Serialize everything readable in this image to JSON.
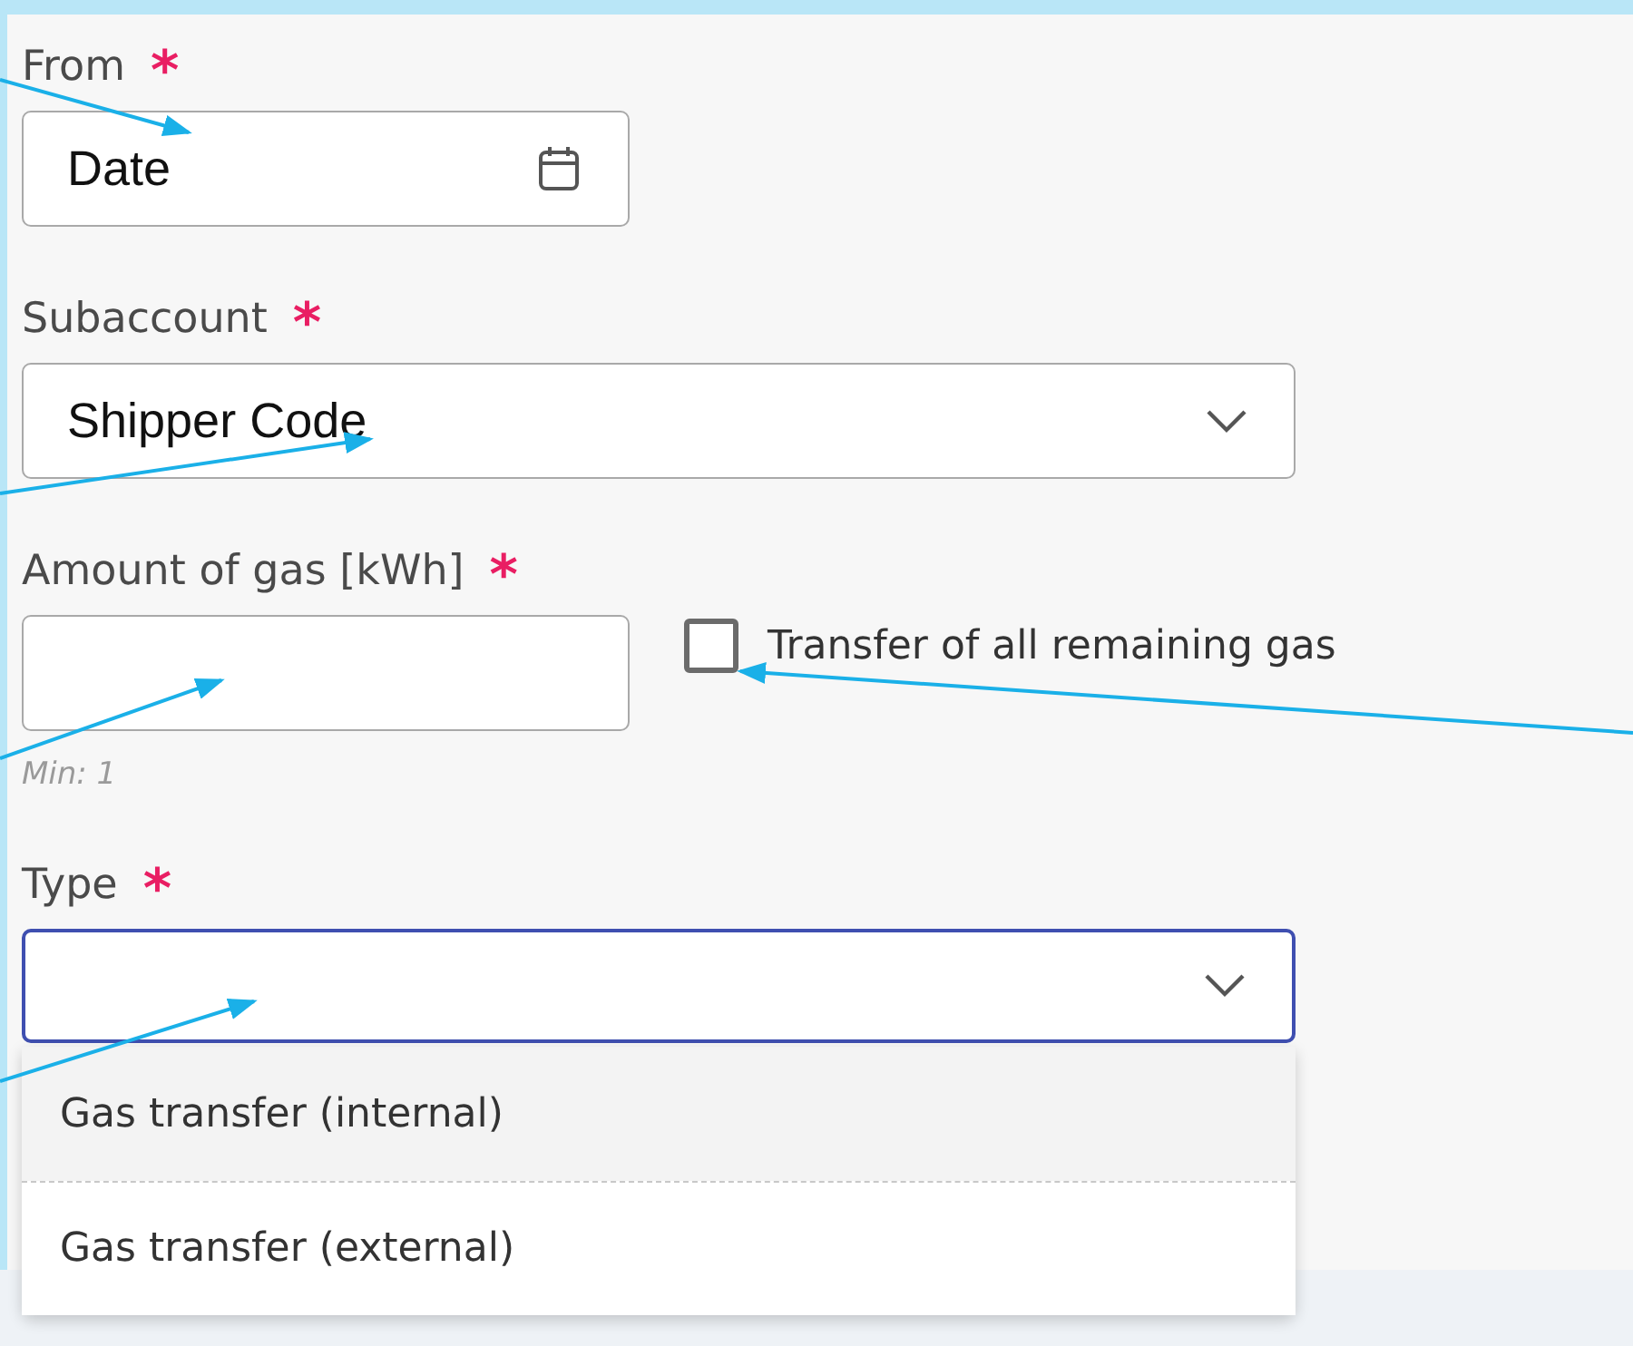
{
  "fields": [
    {
      "kind": "date",
      "label": "From",
      "required_mark": "*",
      "value": "Date"
    },
    {
      "kind": "select",
      "label": "Subaccount",
      "required_mark": "*",
      "value": "Shipper Code",
      "focused": false
    },
    {
      "kind": "number",
      "label": "Amount of gas [kWh]",
      "required_mark": "*",
      "hint": "Min: 1",
      "checkbox": {
        "label": "Transfer of all remaining gas",
        "checked": false
      }
    },
    {
      "kind": "select",
      "label": "Type",
      "required_mark": "*",
      "focused": true,
      "expanded": true,
      "options": [
        {
          "label": "Gas transfer (internal)",
          "highlighted": true
        },
        {
          "label": "Gas transfer (external)",
          "highlighted": false
        }
      ]
    }
  ]
}
